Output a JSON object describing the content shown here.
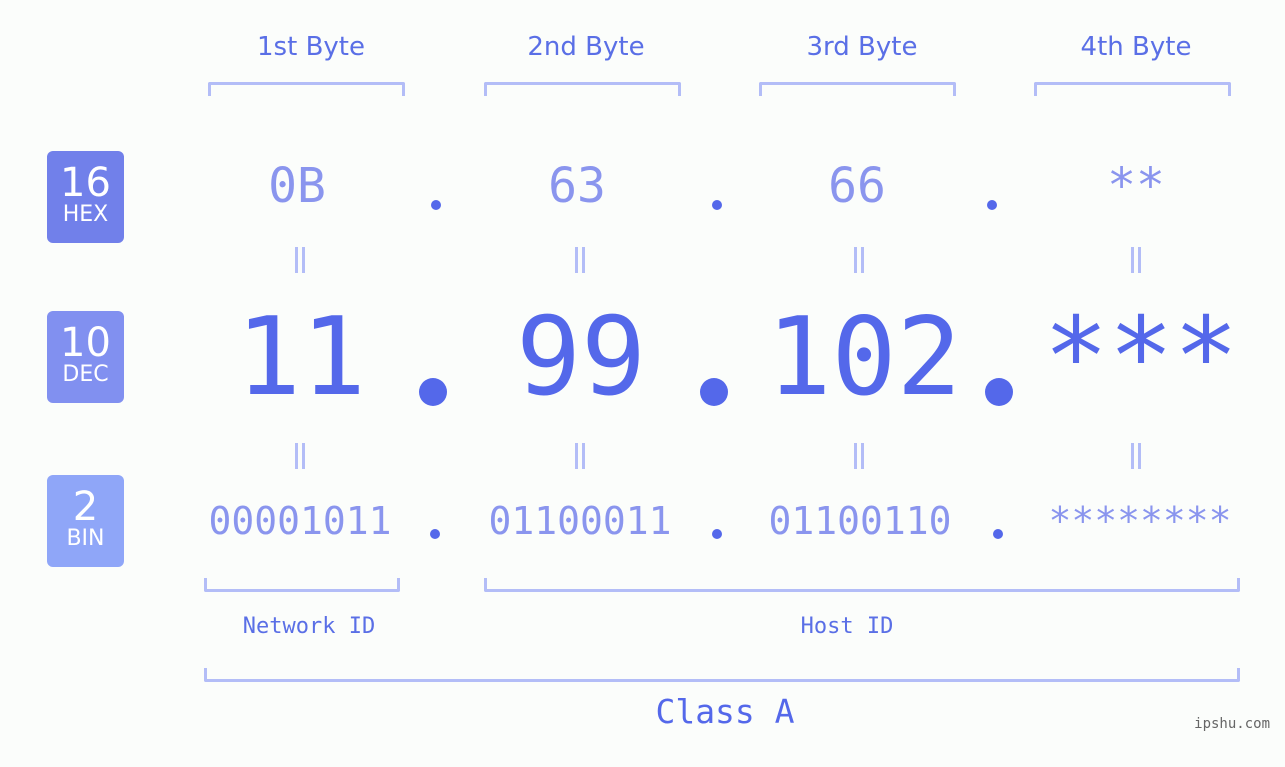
{
  "byte_headers": [
    "1st Byte",
    "2nd Byte",
    "3rd Byte",
    "4th Byte"
  ],
  "badges": [
    {
      "number": "16",
      "label": "HEX",
      "color": "#7180ea"
    },
    {
      "number": "10",
      "label": "DEC",
      "color": "#8190f0"
    },
    {
      "number": "2",
      "label": "BIN",
      "color": "#8fa6f8"
    }
  ],
  "hex": [
    "0B",
    "63",
    "66",
    "**"
  ],
  "dec": [
    "11",
    "99",
    "102",
    "***"
  ],
  "bin": [
    "00001011",
    "01100011",
    "01100110",
    "********"
  ],
  "network_label": "Network ID",
  "host_label": "Host ID",
  "class_label": "Class A",
  "watermark": "ipshu.com",
  "colors": {
    "accent": "#5468ea",
    "light_value": "#8a95ee",
    "bracket": "#b3bdf7",
    "background": "#fbfdfb"
  }
}
